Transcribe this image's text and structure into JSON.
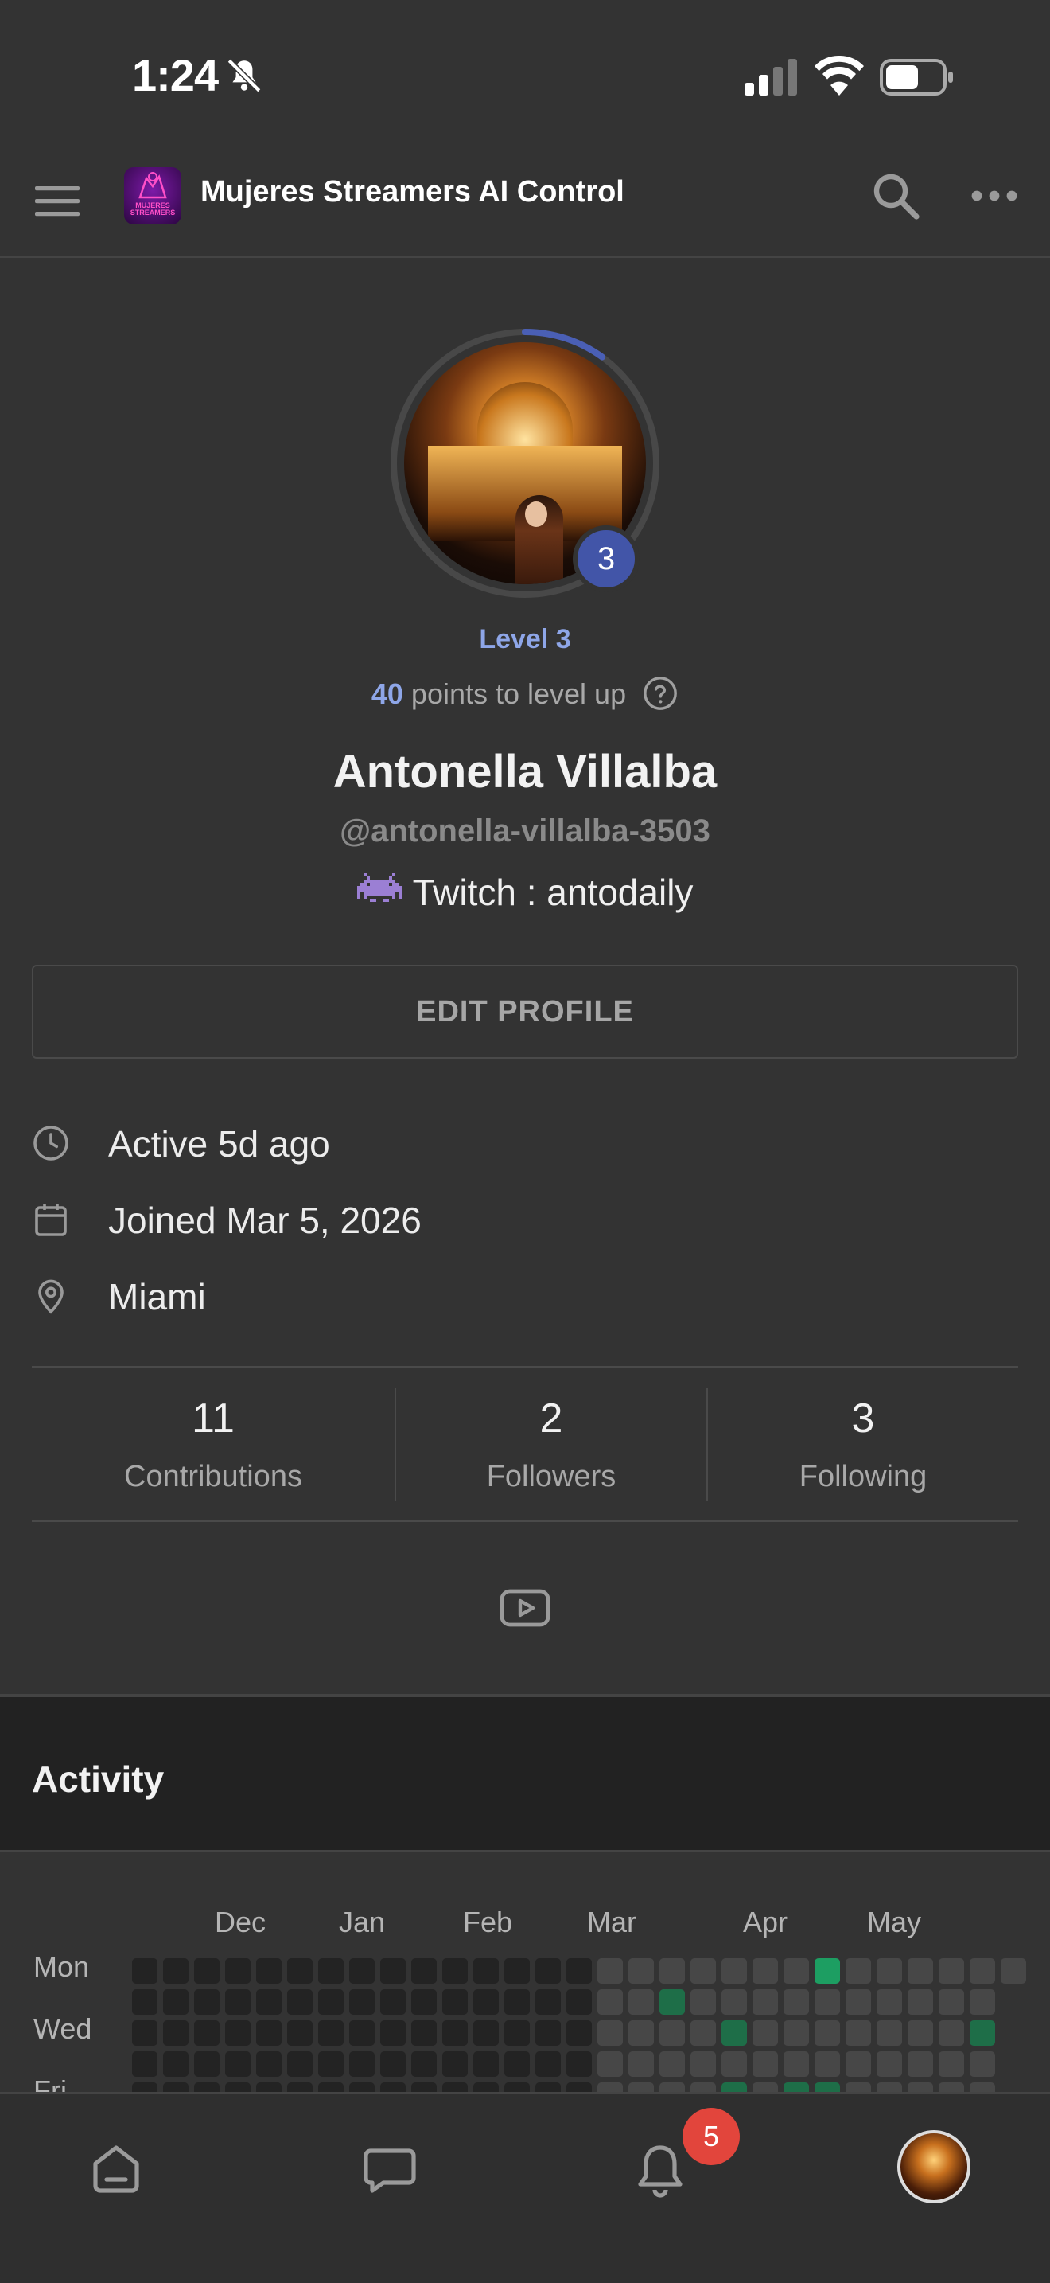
{
  "status_bar": {
    "time": "1:24"
  },
  "header": {
    "title": "Mujeres Streamers AI Control",
    "logo_text": "MUJERES STREAMERS"
  },
  "profile": {
    "level_number": "3",
    "level_label": "Level 3",
    "points": "40",
    "points_suffix": "points to level up",
    "level_progress_fraction": 0.1,
    "display_name": "Antonella Villalba",
    "username": "@antonella-villalba-3503",
    "status_text": "Twitch : antodaily",
    "edit_button": "EDIT PROFILE"
  },
  "meta": {
    "active": "Active 5d ago",
    "joined": "Joined Mar 5, 2026",
    "location": "Miami"
  },
  "stats": [
    {
      "value": "11",
      "label": "Contributions"
    },
    {
      "value": "2",
      "label": "Followers"
    },
    {
      "value": "3",
      "label": "Following"
    }
  ],
  "activity": {
    "title": "Activity",
    "months": [
      "Dec",
      "Jan",
      "Feb",
      "Mar",
      "Apr",
      "May"
    ],
    "days": [
      "Mon",
      "Wed",
      "Fri"
    ]
  },
  "nav": {
    "notification_count": "5"
  },
  "colors": {
    "accent": "#4255a8",
    "level_text": "#8ea6e8",
    "badge": "#e2453c",
    "activity_green": "#1d9e62"
  }
}
